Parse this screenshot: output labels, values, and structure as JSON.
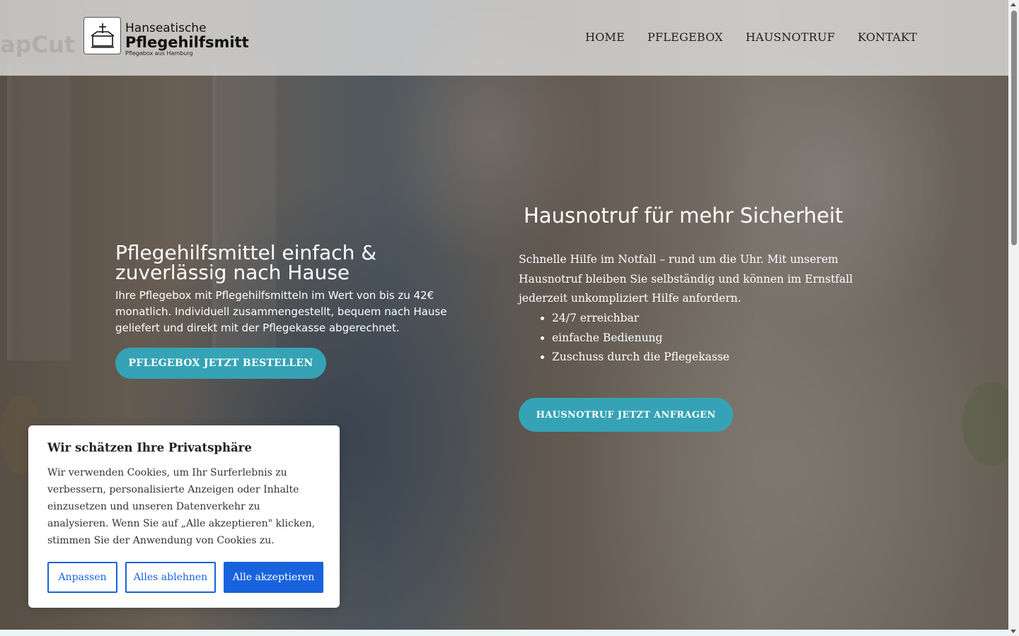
{
  "header": {
    "watermark": "apCut",
    "logo": {
      "line1": "Hanseatische",
      "line2": "Pflegehilfsmitt",
      "line3": "Pflegebox aus Hamburg",
      "icon": "box-with-cross-icon"
    },
    "nav": [
      "HOME",
      "PFLEGEBOX",
      "HAUSNOTRUF",
      "KONTAKT"
    ]
  },
  "hero_left": {
    "title": "Pflegehilfsmittel einfach & zuverlässig nach Hause",
    "text": "Ihre Pflegebox mit Pflegehilfsmitteln im Wert von bis zu 42€ monatlich. Individuell zusammengestellt, bequem nach Hause geliefert und direkt mit der Pflegekasse abgerechnet.",
    "button": "PFLEGEBOX JETZT BESTELLEN"
  },
  "hero_right": {
    "title": "Hausnotruf für mehr Sicherheit",
    "text": "Schnelle Hilfe im Notfall – rund um die Uhr. Mit unserem Hausnotruf bleiben Sie selbständig und können im Ernstfall jederzeit unkompliziert Hilfe anfordern.",
    "bullets": [
      "24/7 erreichbar",
      "einfache Bedienung",
      "Zuschuss durch die Pflegekasse"
    ],
    "button": "HAUSNOTRUF JETZT ANFRAGEN"
  },
  "cookie": {
    "title": "Wir schätzen Ihre Privatsphäre",
    "text": "Wir verwenden Cookies, um Ihr Surferlebnis zu verbessern, personalisierte Anzeigen oder Inhalte einzusetzen und unseren Datenverkehr zu analysieren. Wenn Sie auf „Alle akzeptieren\" klicken, stimmen Sie der Anwendung von Cookies zu.",
    "buttons": {
      "customize": "Anpassen",
      "reject": "Alles ablehnen",
      "accept": "Alle akzeptieren"
    }
  },
  "colors": {
    "teal_button": "#35a3b5",
    "cookie_blue": "#1863dc"
  }
}
